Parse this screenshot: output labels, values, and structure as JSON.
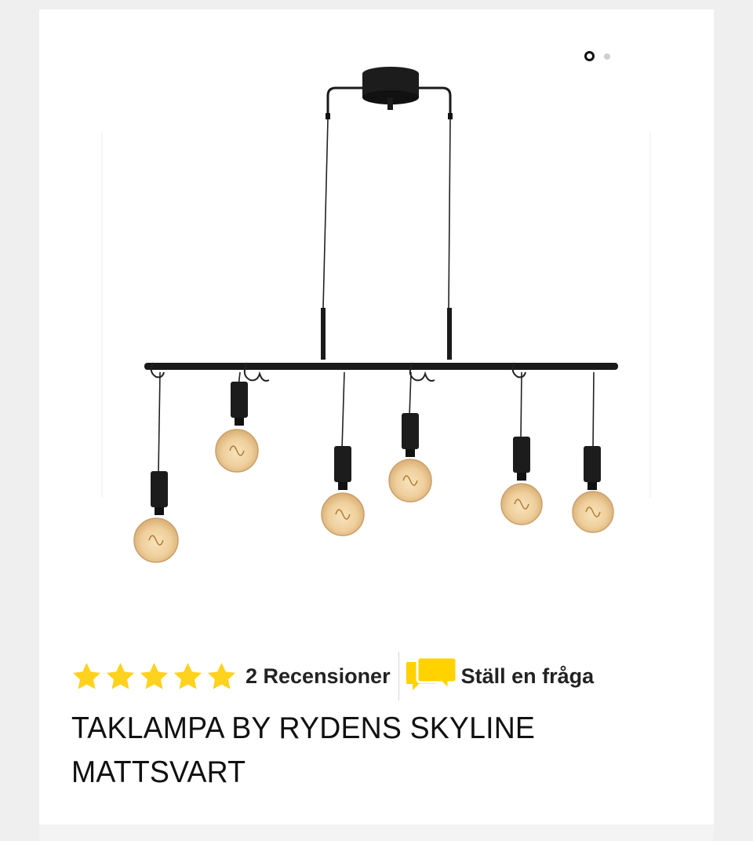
{
  "gallery": {
    "image_alt": "Taklampa By Rydens Skyline mattsvart",
    "image_count": 2,
    "active_index": 1
  },
  "rating": {
    "stars": 5,
    "max_stars": 5,
    "reviews_label": "2 Recensioner"
  },
  "question": {
    "label": "Ställ en fråga",
    "icon": "chat-bubbles-icon"
  },
  "product": {
    "title_line1": "TAKLAMPA BY RYDENS SKYLINE",
    "title_line2": "MATTSVART"
  },
  "colors": {
    "star": "#FFD21F",
    "chat_icon": "#FFD200",
    "text": "#1a1a1a",
    "background": "#efefef",
    "card": "#ffffff"
  }
}
